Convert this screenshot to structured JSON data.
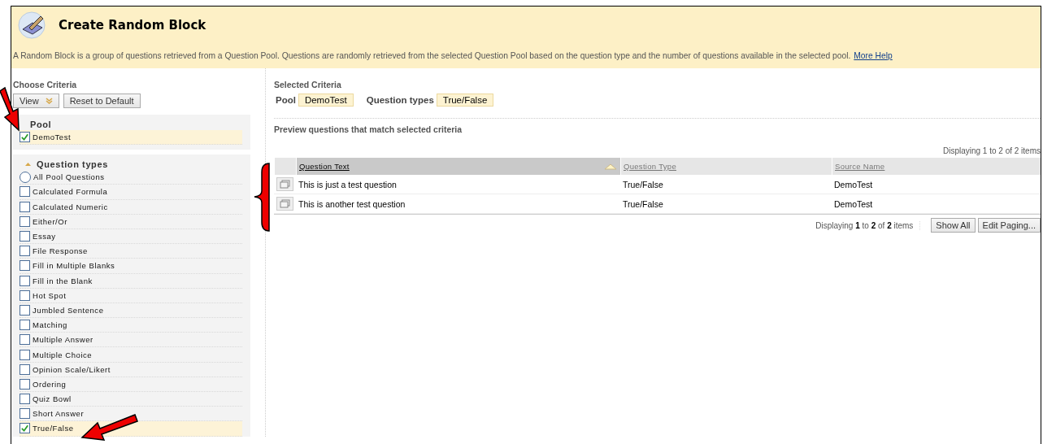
{
  "header": {
    "title": "Create Random Block",
    "description": "A Random Block is a group of questions retrieved from a Question Pool. Questions are randomly retrieved from the selected Question Pool based on the question type and the number of questions available in the selected pool.",
    "help_link": "More Help"
  },
  "criteria": {
    "title": "Choose Criteria",
    "buttons": [
      {
        "label": "View",
        "kind": "menu"
      },
      {
        "label": "Reset to Default",
        "kind": "plain"
      }
    ],
    "pool": {
      "title": "Pool",
      "items": [
        {
          "label": "DemoTest",
          "kind": "checkbox",
          "checked": true
        }
      ]
    },
    "question_types": {
      "title": "Question types",
      "expanded": true,
      "items": [
        {
          "label": "All Pool Questions",
          "kind": "radio",
          "checked": false
        },
        {
          "label": "Calculated Formula",
          "kind": "checkbox",
          "checked": false
        },
        {
          "label": "Calculated Numeric",
          "kind": "checkbox",
          "checked": false
        },
        {
          "label": "Either/Or",
          "kind": "checkbox",
          "checked": false
        },
        {
          "label": "Essay",
          "kind": "checkbox",
          "checked": false
        },
        {
          "label": "File Response",
          "kind": "checkbox",
          "checked": false
        },
        {
          "label": "Fill in Multiple Blanks",
          "kind": "checkbox",
          "checked": false
        },
        {
          "label": "Fill in the Blank",
          "kind": "checkbox",
          "checked": false
        },
        {
          "label": "Hot Spot",
          "kind": "checkbox",
          "checked": false
        },
        {
          "label": "Jumbled Sentence",
          "kind": "checkbox",
          "checked": false
        },
        {
          "label": "Matching",
          "kind": "checkbox",
          "checked": false
        },
        {
          "label": "Multiple Answer",
          "kind": "checkbox",
          "checked": false
        },
        {
          "label": "Multiple Choice",
          "kind": "checkbox",
          "checked": false
        },
        {
          "label": "Opinion Scale/Likert",
          "kind": "checkbox",
          "checked": false
        },
        {
          "label": "Ordering",
          "kind": "checkbox",
          "checked": false
        },
        {
          "label": "Quiz Bowl",
          "kind": "checkbox",
          "checked": false
        },
        {
          "label": "Short Answer",
          "kind": "checkbox",
          "checked": false
        },
        {
          "label": "True/False",
          "kind": "checkbox",
          "checked": true
        }
      ]
    }
  },
  "selected_criteria": {
    "title": "Selected Criteria",
    "filters": [
      {
        "label": "Pool",
        "value": "DemoTest"
      },
      {
        "label": "Question types",
        "value": "True/False"
      }
    ]
  },
  "preview": {
    "title": "Preview questions that match selected criteria",
    "top_count": "Displaying 1 to 2 of 2 items",
    "columns": [
      {
        "label": "Question Text",
        "sorted": true
      },
      {
        "label": "Question Type",
        "sorted": false
      },
      {
        "label": "Source Name",
        "sorted": false
      }
    ],
    "rows": [
      {
        "question_text": "This is just a test question",
        "question_type": "True/False",
        "source_name": "DemoTest"
      },
      {
        "question_text": "This is another test question",
        "question_type": "True/False",
        "source_name": "DemoTest"
      }
    ],
    "bottom_count": "Displaying **1** to **2** of **2** items",
    "buttons": [
      "Show All",
      "Edit Paging..."
    ]
  }
}
